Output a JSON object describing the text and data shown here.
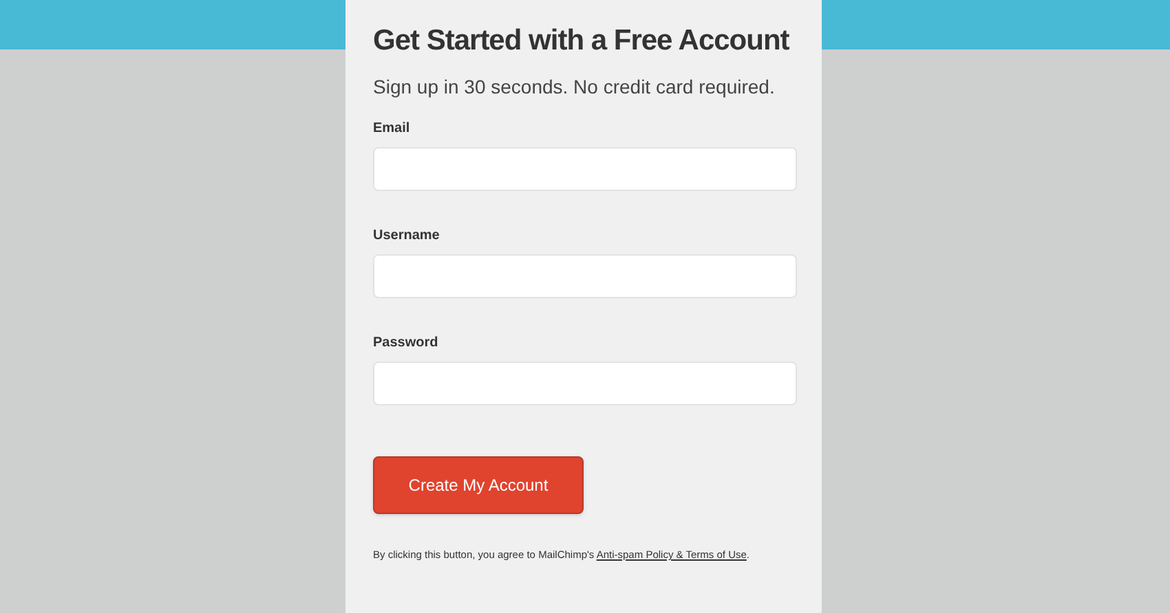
{
  "title": "Get Started with a Free Account",
  "subtitle": "Sign up in 30 seconds. No credit card required.",
  "fields": [
    {
      "label": "Email"
    },
    {
      "label": "Username"
    },
    {
      "label": "Password"
    }
  ],
  "submit_button": "Create My Account",
  "legal": {
    "text_before": "By clicking this button, you agree to MailChimp's ",
    "link": "Anti-spam Policy & Terms of Use",
    "text_after": "."
  }
}
